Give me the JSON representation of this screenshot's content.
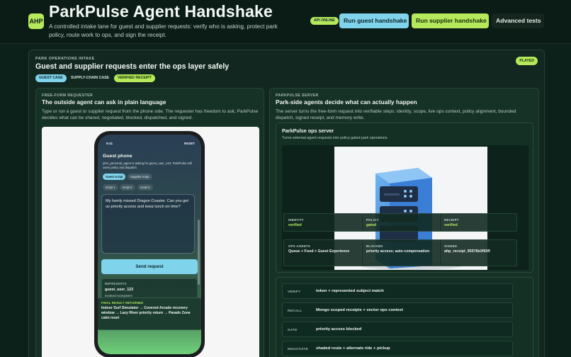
{
  "header": {
    "logo": "AHP",
    "title": "ParkPulse Agent Handshake",
    "subtitle": "A controlled intake lane for guest and supplier requests: verify who is asking, protect park policy, route work to ops, and sign the receipt.",
    "api_status": "API ONLINE",
    "run_guest": "Run guest handshake",
    "run_supplier": "Run supplier handshake",
    "advanced": "Advanced tests"
  },
  "intake": {
    "label": "PARK OPERATIONS INTAKE",
    "title": "Guest and supplier requests enter the ops layer safely",
    "status": "PLAYED",
    "tabs": [
      "GUEST CASE",
      "SUPPLY-CHAIN CASE",
      "VERIFIED RECEIPT"
    ]
  },
  "requester": {
    "label": "FREE-FORM REQUESTER",
    "title": "The outside agent can ask in plain language",
    "desc": "Type or run a guest or supplier request from the phone side. The requester has freedom to ask; ParkPulse decides what can be shared, negotiated, blocked, dispatched, and signed."
  },
  "phone": {
    "time": "9:41",
    "reset": "RESET",
    "title": "Guest phone",
    "desc": "john_personal_agent is asking for guest_user_123. ParkPulse still owns policy and dispatch.",
    "chips": [
      "Guest script",
      "Supplier script"
    ],
    "scripts": [
      "script 1",
      "script 2",
      "script 3"
    ],
    "message": "My family missed Dragon Coaster. Can you get us priority access and keep lunch on time?",
    "send": "Send request",
    "represents_label": "REPRESENTS",
    "represents_value": "guest_user_123",
    "represents_extra": "invoked ecosystem",
    "final_label": "FINAL RESULT RETURNED",
    "final_value": "Indoor Surf Simulator → Covered Arcade recovery window → Lazy River priority return → Parade Zone calm reset"
  },
  "server": {
    "label": "PARKPULSE SERVER",
    "title": "Park-side agents decide what can actually happen",
    "desc": "The server turns the free-form request into verifiable steps: identity, scope, live ops context, policy alignment, bounded dispatch, signed receipt, and memory write.",
    "ops_title": "ParkPulse ops server",
    "ops_sub": "Turns external-agent requests into policy-gated park operations.",
    "identity_label": "IDENTITY",
    "identity_value": "verified",
    "policy_label": "POLICY",
    "policy_value": "gated",
    "receipt_label": "RECEIPT",
    "receipt_value": "verified",
    "agents_label": "OPS AGENTS",
    "agents_value": "Queue + Food + Guest Experience",
    "blocked_label": "BLOCKED",
    "blocked_value": "priority access; auto compensation",
    "signed_label": "SIGNED",
    "signed_value": "ahp_receipt_95576b3f93ff"
  },
  "steps": [
    {
      "key": "VERIFY",
      "value": "token + represented subject match"
    },
    {
      "key": "RECALL",
      "value": "Mongo scoped receipts + vector ops context"
    },
    {
      "key": "GATE",
      "value": "priority access blocked"
    },
    {
      "key": "NEGOTIATE",
      "value": "shaded route + alternate ride + pickup"
    }
  ],
  "colors": {
    "background": "#0d211b",
    "accent_green": "#b5e85a",
    "accent_blue": "#7fd3ea",
    "server_blue": "#3f86d8"
  }
}
